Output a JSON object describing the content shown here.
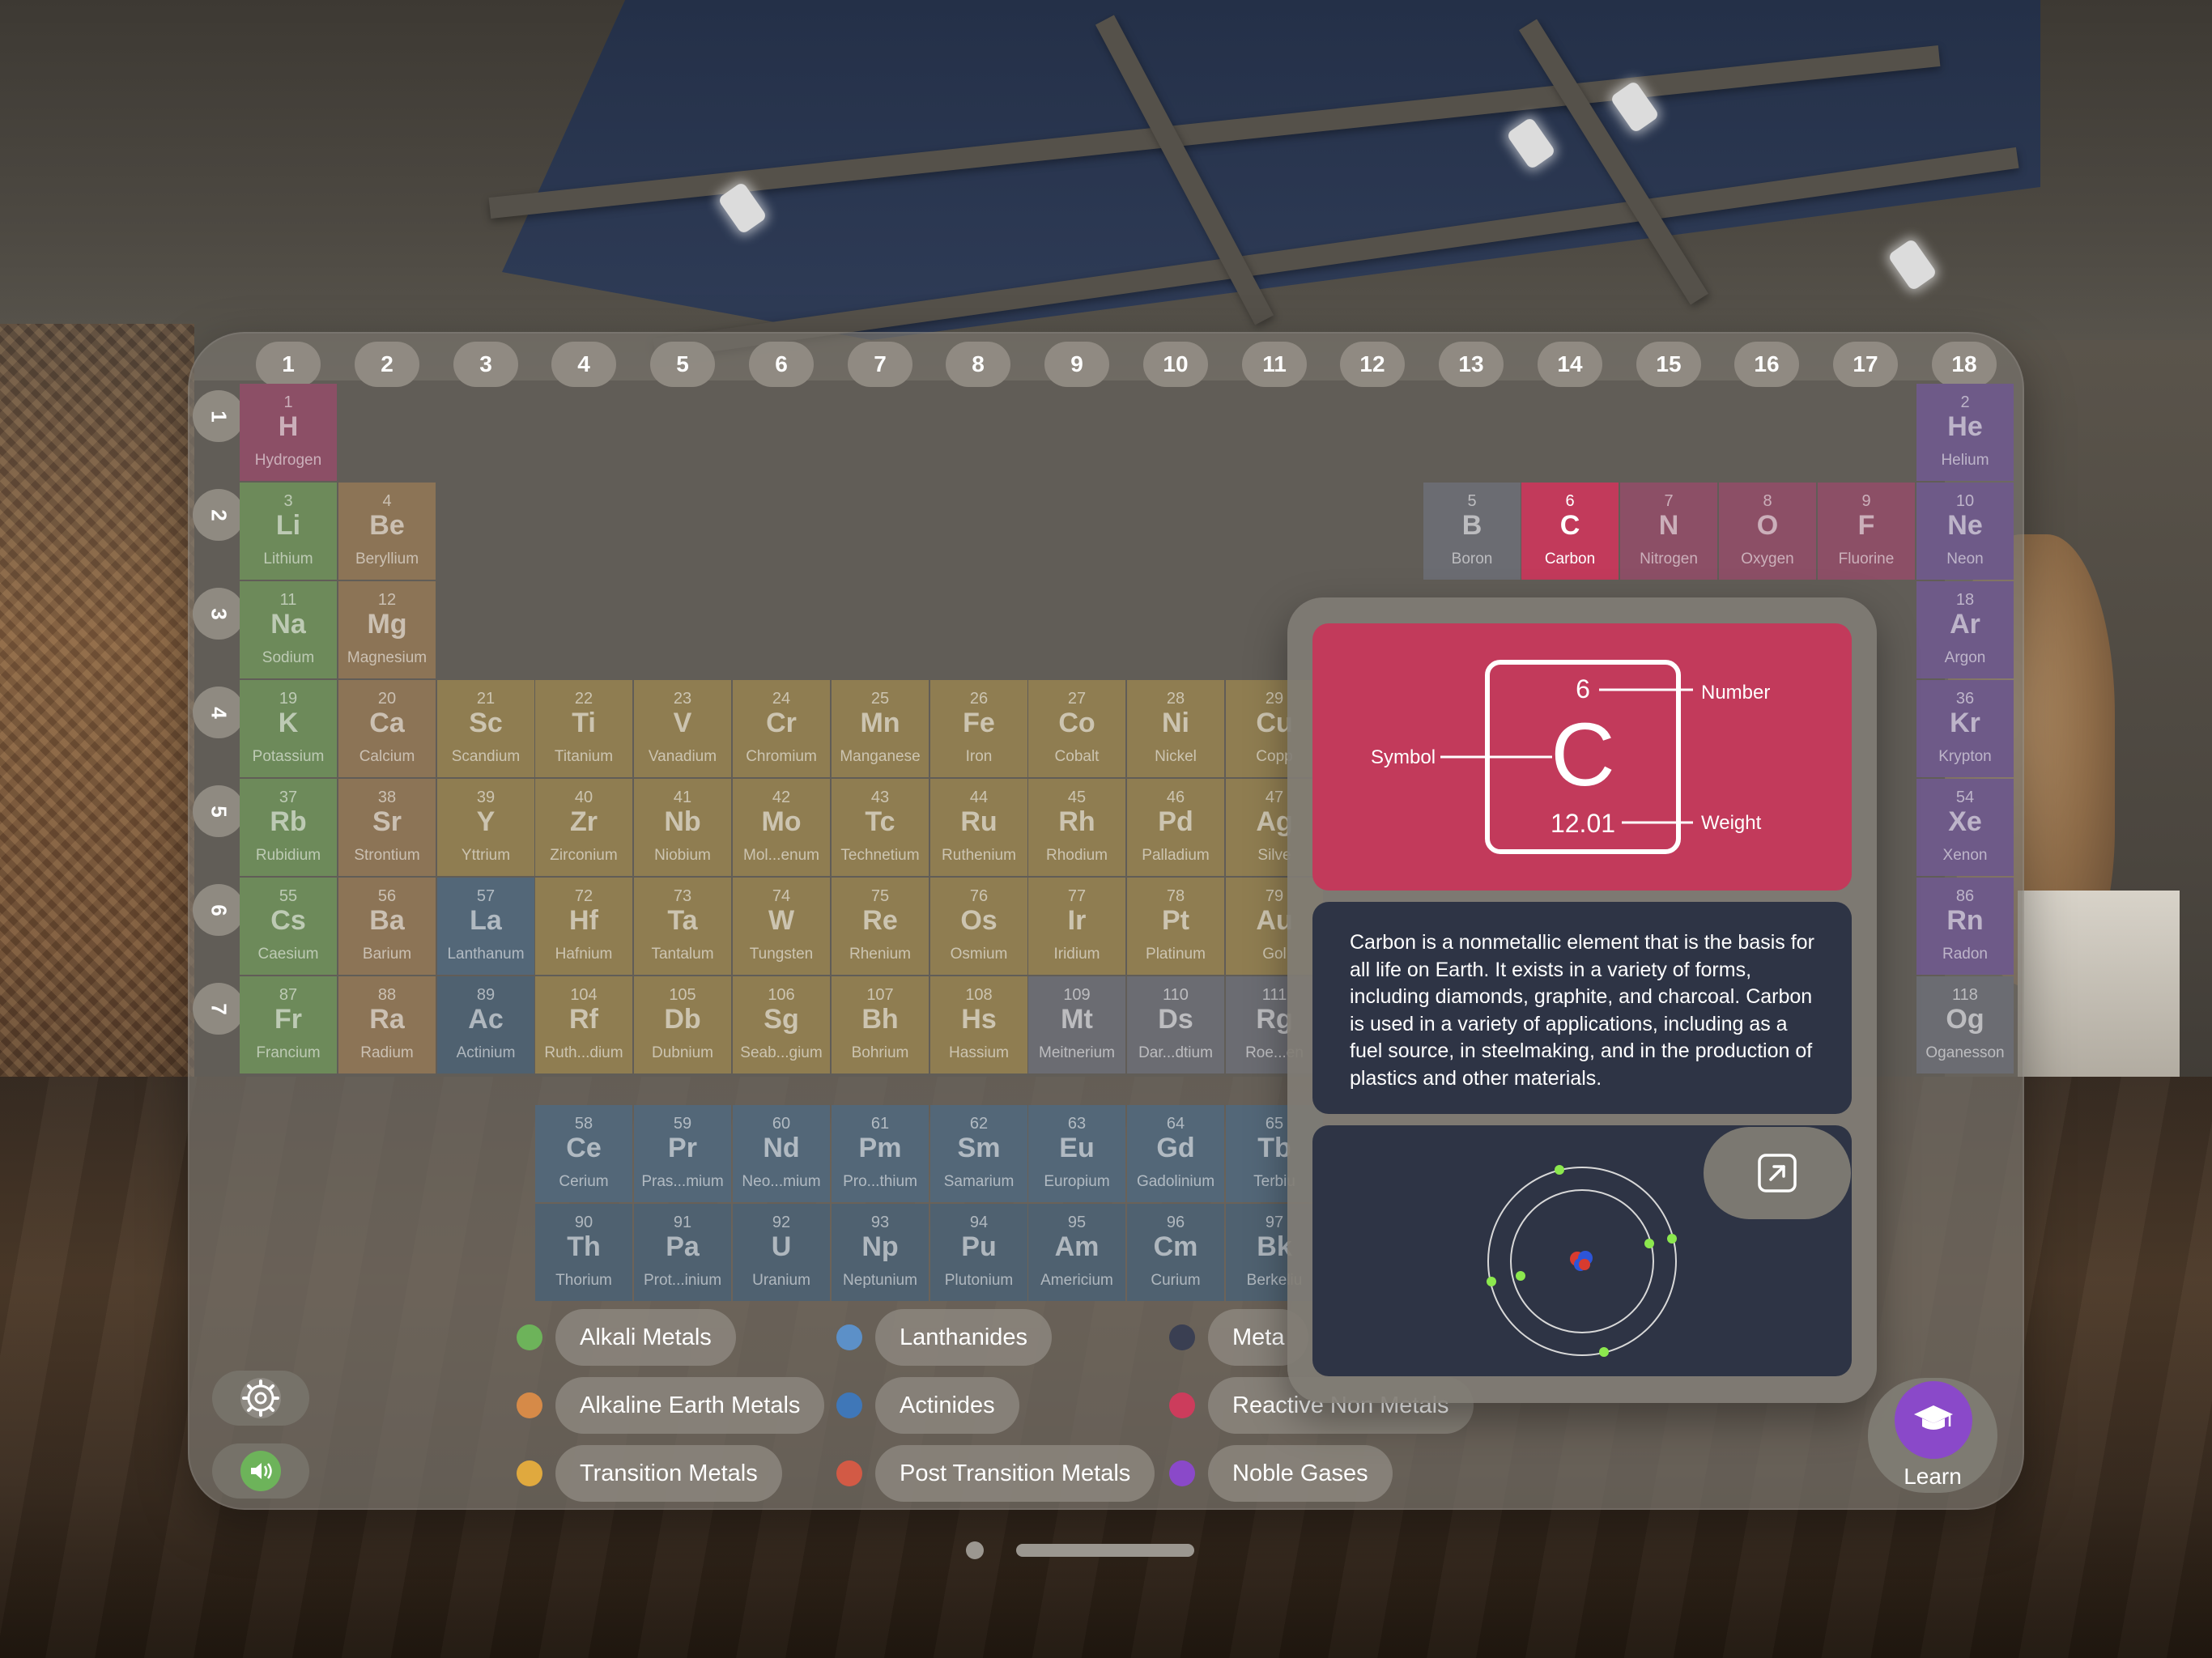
{
  "groups": [
    "1",
    "2",
    "3",
    "4",
    "5",
    "6",
    "7",
    "8",
    "9",
    "10",
    "11",
    "12",
    "13",
    "14",
    "15",
    "16",
    "17",
    "18"
  ],
  "periods": [
    "1",
    "2",
    "3",
    "4",
    "5",
    "6",
    "7"
  ],
  "elements": [
    {
      "n": "1",
      "s": "H",
      "name": "Hydrogen",
      "cat": "react"
    },
    {
      "n": "2",
      "s": "He",
      "name": "Helium",
      "cat": "noble"
    },
    {
      "n": "3",
      "s": "Li",
      "name": "Lithium",
      "cat": "alkali"
    },
    {
      "n": "4",
      "s": "Be",
      "name": "Beryllium",
      "cat": "earth"
    },
    {
      "n": "5",
      "s": "B",
      "name": "Boron",
      "cat": "metal"
    },
    {
      "n": "6",
      "s": "C",
      "name": "Carbon",
      "cat": "selected"
    },
    {
      "n": "7",
      "s": "N",
      "name": "Nitrogen",
      "cat": "react"
    },
    {
      "n": "8",
      "s": "O",
      "name": "Oxygen",
      "cat": "react"
    },
    {
      "n": "9",
      "s": "F",
      "name": "Fluorine",
      "cat": "react"
    },
    {
      "n": "10",
      "s": "Ne",
      "name": "Neon",
      "cat": "noble"
    },
    {
      "n": "11",
      "s": "Na",
      "name": "Sodium",
      "cat": "alkali"
    },
    {
      "n": "12",
      "s": "Mg",
      "name": "Magnesium",
      "cat": "earth"
    },
    {
      "n": "18",
      "s": "Ar",
      "name": "Argon",
      "cat": "noble"
    },
    {
      "n": "19",
      "s": "K",
      "name": "Potassium",
      "cat": "alkali"
    },
    {
      "n": "20",
      "s": "Ca",
      "name": "Calcium",
      "cat": "earth"
    },
    {
      "n": "21",
      "s": "Sc",
      "name": "Scandium",
      "cat": "trans"
    },
    {
      "n": "22",
      "s": "Ti",
      "name": "Titanium",
      "cat": "trans"
    },
    {
      "n": "23",
      "s": "V",
      "name": "Vanadium",
      "cat": "trans"
    },
    {
      "n": "24",
      "s": "Cr",
      "name": "Chromium",
      "cat": "trans"
    },
    {
      "n": "25",
      "s": "Mn",
      "name": "Manganese",
      "cat": "trans"
    },
    {
      "n": "26",
      "s": "Fe",
      "name": "Iron",
      "cat": "trans"
    },
    {
      "n": "27",
      "s": "Co",
      "name": "Cobalt",
      "cat": "trans"
    },
    {
      "n": "28",
      "s": "Ni",
      "name": "Nickel",
      "cat": "trans"
    },
    {
      "n": "29",
      "s": "Cu",
      "name": "Copp",
      "cat": "trans"
    },
    {
      "n": "36",
      "s": "Kr",
      "name": "Krypton",
      "cat": "noble"
    },
    {
      "n": "37",
      "s": "Rb",
      "name": "Rubidium",
      "cat": "alkali"
    },
    {
      "n": "38",
      "s": "Sr",
      "name": "Strontium",
      "cat": "earth"
    },
    {
      "n": "39",
      "s": "Y",
      "name": "Yttrium",
      "cat": "trans"
    },
    {
      "n": "40",
      "s": "Zr",
      "name": "Zirconium",
      "cat": "trans"
    },
    {
      "n": "41",
      "s": "Nb",
      "name": "Niobium",
      "cat": "trans"
    },
    {
      "n": "42",
      "s": "Mo",
      "name": "Mol...enum",
      "cat": "trans"
    },
    {
      "n": "43",
      "s": "Tc",
      "name": "Technetium",
      "cat": "trans"
    },
    {
      "n": "44",
      "s": "Ru",
      "name": "Ruthenium",
      "cat": "trans"
    },
    {
      "n": "45",
      "s": "Rh",
      "name": "Rhodium",
      "cat": "trans"
    },
    {
      "n": "46",
      "s": "Pd",
      "name": "Palladium",
      "cat": "trans"
    },
    {
      "n": "47",
      "s": "Ag",
      "name": "Silve",
      "cat": "trans"
    },
    {
      "n": "54",
      "s": "Xe",
      "name": "Xenon",
      "cat": "noble"
    },
    {
      "n": "55",
      "s": "Cs",
      "name": "Caesium",
      "cat": "alkali"
    },
    {
      "n": "56",
      "s": "Ba",
      "name": "Barium",
      "cat": "earth"
    },
    {
      "n": "57",
      "s": "La",
      "name": "Lanthanum",
      "cat": "lanth"
    },
    {
      "n": "72",
      "s": "Hf",
      "name": "Hafnium",
      "cat": "trans"
    },
    {
      "n": "73",
      "s": "Ta",
      "name": "Tantalum",
      "cat": "trans"
    },
    {
      "n": "74",
      "s": "W",
      "name": "Tungsten",
      "cat": "trans"
    },
    {
      "n": "75",
      "s": "Re",
      "name": "Rhenium",
      "cat": "trans"
    },
    {
      "n": "76",
      "s": "Os",
      "name": "Osmium",
      "cat": "trans"
    },
    {
      "n": "77",
      "s": "Ir",
      "name": "Iridium",
      "cat": "trans"
    },
    {
      "n": "78",
      "s": "Pt",
      "name": "Platinum",
      "cat": "trans"
    },
    {
      "n": "79",
      "s": "Au",
      "name": "Gol",
      "cat": "trans"
    },
    {
      "n": "86",
      "s": "Rn",
      "name": "Radon",
      "cat": "noble"
    },
    {
      "n": "87",
      "s": "Fr",
      "name": "Francium",
      "cat": "alkali"
    },
    {
      "n": "88",
      "s": "Ra",
      "name": "Radium",
      "cat": "earth"
    },
    {
      "n": "89",
      "s": "Ac",
      "name": "Actinium",
      "cat": "act"
    },
    {
      "n": "104",
      "s": "Rf",
      "name": "Ruth...dium",
      "cat": "trans"
    },
    {
      "n": "105",
      "s": "Db",
      "name": "Dubnium",
      "cat": "trans"
    },
    {
      "n": "106",
      "s": "Sg",
      "name": "Seab...gium",
      "cat": "trans"
    },
    {
      "n": "107",
      "s": "Bh",
      "name": "Bohrium",
      "cat": "trans"
    },
    {
      "n": "108",
      "s": "Hs",
      "name": "Hassium",
      "cat": "trans"
    },
    {
      "n": "109",
      "s": "Mt",
      "name": "Meitnerium",
      "cat": "metal"
    },
    {
      "n": "110",
      "s": "Ds",
      "name": "Dar...dtium",
      "cat": "metal"
    },
    {
      "n": "111",
      "s": "Rg",
      "name": "Roe...en",
      "cat": "metal"
    },
    {
      "n": "118",
      "s": "Og",
      "name": "Oganesson",
      "cat": "metal"
    },
    {
      "n": "58",
      "s": "Ce",
      "name": "Cerium",
      "cat": "lanth"
    },
    {
      "n": "59",
      "s": "Pr",
      "name": "Pras...mium",
      "cat": "lanth"
    },
    {
      "n": "60",
      "s": "Nd",
      "name": "Neo...mium",
      "cat": "lanth"
    },
    {
      "n": "61",
      "s": "Pm",
      "name": "Pro...thium",
      "cat": "lanth"
    },
    {
      "n": "62",
      "s": "Sm",
      "name": "Samarium",
      "cat": "lanth"
    },
    {
      "n": "63",
      "s": "Eu",
      "name": "Europium",
      "cat": "lanth"
    },
    {
      "n": "64",
      "s": "Gd",
      "name": "Gadolinium",
      "cat": "lanth"
    },
    {
      "n": "65",
      "s": "Tb",
      "name": "Terbiu",
      "cat": "lanth"
    },
    {
      "n": "90",
      "s": "Th",
      "name": "Thorium",
      "cat": "act"
    },
    {
      "n": "91",
      "s": "Pa",
      "name": "Prot...inium",
      "cat": "act"
    },
    {
      "n": "92",
      "s": "U",
      "name": "Uranium",
      "cat": "act"
    },
    {
      "n": "93",
      "s": "Np",
      "name": "Neptunium",
      "cat": "act"
    },
    {
      "n": "94",
      "s": "Pu",
      "name": "Plutonium",
      "cat": "act"
    },
    {
      "n": "95",
      "s": "Am",
      "name": "Americium",
      "cat": "act"
    },
    {
      "n": "96",
      "s": "Cm",
      "name": "Curium",
      "cat": "act"
    },
    {
      "n": "97",
      "s": "Bk",
      "name": "Berkeliu",
      "cat": "act"
    }
  ],
  "legend": [
    {
      "label": "Alkali Metals",
      "color": "#6db35a"
    },
    {
      "label": "Alkaline Earth Metals",
      "color": "#d68a48"
    },
    {
      "label": "Transition Metals",
      "color": "#e0a93e"
    },
    {
      "label": "Lanthanides",
      "color": "#5c90c8"
    },
    {
      "label": "Actinides",
      "color": "#3f77b8"
    },
    {
      "label": "Post Transition Metals",
      "color": "#d25a45"
    },
    {
      "label": "Meta",
      "color": "#3a3f52"
    },
    {
      "label": "Reactive Non Metals",
      "color": "#cc3c5c"
    },
    {
      "label": "Noble Gases",
      "color": "#8a49c9"
    }
  ],
  "detail": {
    "number": "6",
    "symbol": "C",
    "weight": "12.01",
    "label_number": "Number",
    "label_symbol": "Symbol",
    "label_weight": "Weight",
    "description": "Carbon is a nonmetallic element that is the basis for all life on Earth. It exists in a variety of forms, including diamonds, graphite, and charcoal. Carbon is used in a variety of applications, including as a fuel source, in steelmaking, and in the production of plastics and other materials."
  },
  "controls": {
    "settings_icon": "gear-icon",
    "sound_icon": "speaker-icon",
    "expand_icon": "expand-arrow-icon",
    "learn_icon": "graduation-cap-icon",
    "learn_label": "Learn"
  },
  "colors": {
    "selected": "#c23a5b",
    "panel_dark": "#2e3445",
    "learn": "#8a49c9",
    "sound_active": "#6db35a"
  }
}
